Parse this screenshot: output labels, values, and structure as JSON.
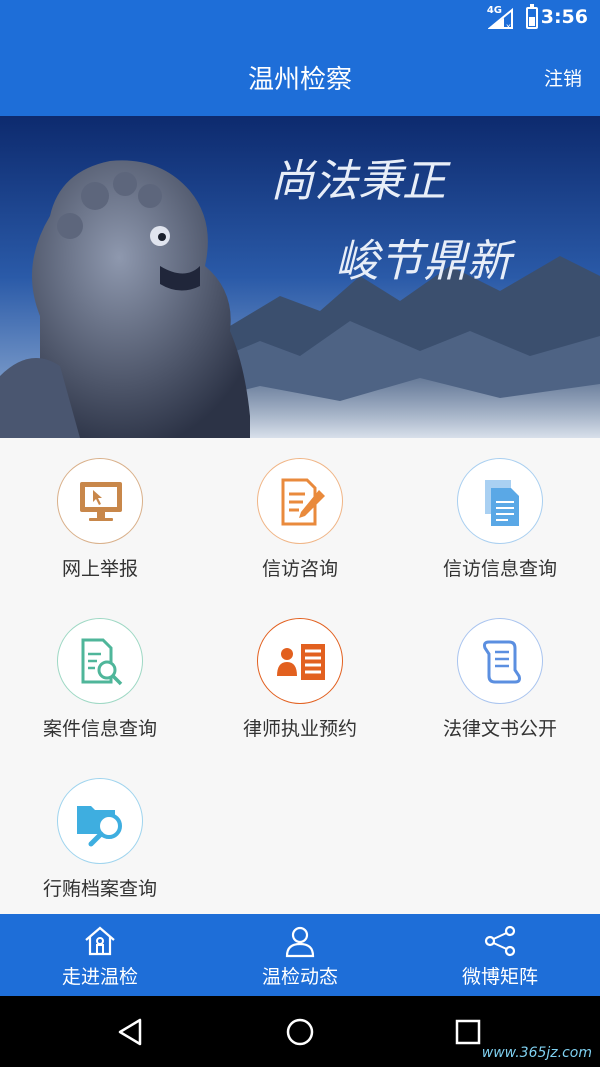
{
  "status_bar": {
    "network": "4G",
    "time": "3:56"
  },
  "app_bar": {
    "title": "温州检察",
    "logout_label": "注销"
  },
  "banner": {
    "line1": "尚法秉正",
    "line2": "峻节鼎新"
  },
  "services": [
    {
      "label": "网上举报",
      "icon": "computer-report-icon",
      "color": "#c8874a"
    },
    {
      "label": "信访咨询",
      "icon": "document-edit-icon",
      "color": "#e98a3c"
    },
    {
      "label": "信访信息查询",
      "icon": "documents-stack-icon",
      "color": "#5aa8e6"
    },
    {
      "label": "案件信息查询",
      "icon": "document-search-icon",
      "color": "#4fb69a"
    },
    {
      "label": "律师执业预约",
      "icon": "lawyer-card-icon",
      "color": "#e2601f"
    },
    {
      "label": "法律文书公开",
      "icon": "scroll-paper-icon",
      "color": "#5b8fe0"
    },
    {
      "label": "行贿档案查询",
      "icon": "folder-search-icon",
      "color": "#3eaee0"
    }
  ],
  "bottom_nav": [
    {
      "label": "走进温检",
      "icon": "home-icon"
    },
    {
      "label": "温检动态",
      "icon": "person-icon"
    },
    {
      "label": "微博矩阵",
      "icon": "share-icon"
    }
  ],
  "watermark": "www.365jz.com"
}
